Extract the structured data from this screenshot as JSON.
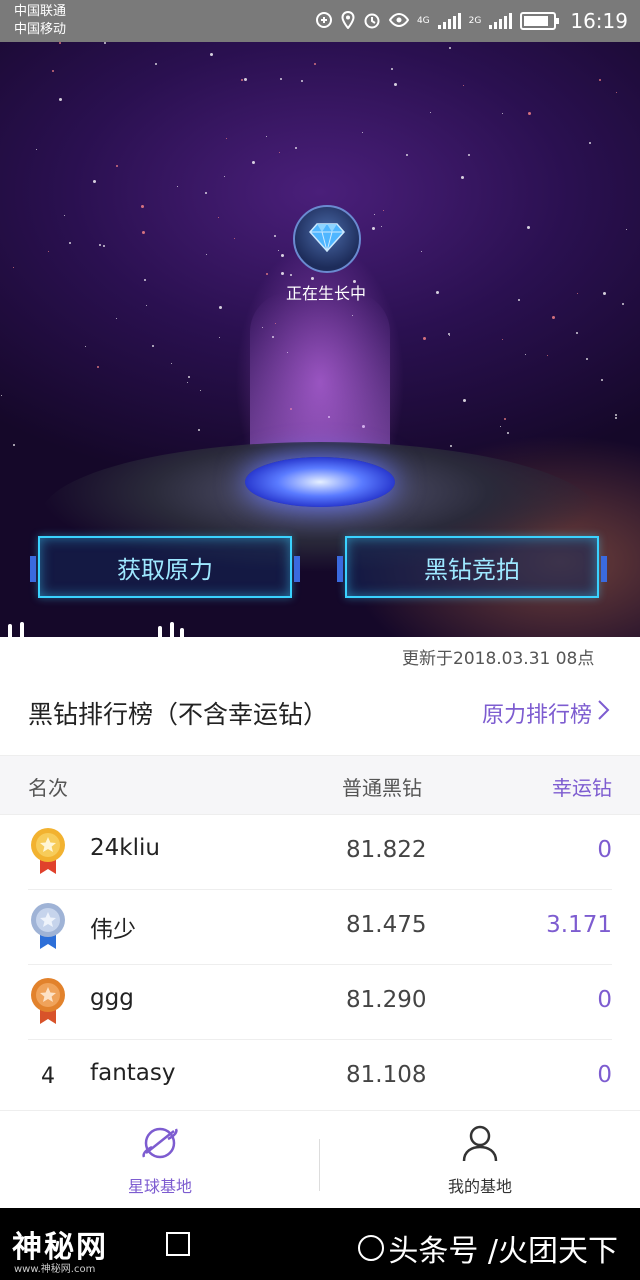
{
  "statusbar": {
    "carrier1": "中国联通",
    "carrier2": "中国移动",
    "net1": "4G",
    "net2": "2G",
    "battery_level": 0.85,
    "time": "16:19"
  },
  "hero": {
    "growing_label": "正在生长中",
    "btn_get_force": "获取原力",
    "btn_auction": "黑钻竞拍"
  },
  "ranking": {
    "updated": "更新于2018.03.31 08点",
    "title": "黑钻排行榜（不含幸运钻）",
    "force_link": "原力排行榜",
    "columns": {
      "rank": "名次",
      "normal": "普通黑钻",
      "lucky": "幸运钻"
    },
    "rows": [
      {
        "medal": "gold",
        "name": "24kliu",
        "normal": "81.822",
        "lucky": "0"
      },
      {
        "medal": "silver",
        "name": "伟少",
        "normal": "81.475",
        "lucky": "3.171"
      },
      {
        "medal": "bronze",
        "name": "ggg",
        "normal": "81.290",
        "lucky": "0"
      },
      {
        "rank": "4",
        "name": "fantasy",
        "normal": "81.108",
        "lucky": "0"
      }
    ]
  },
  "tabs": {
    "planet_base": "星球基地",
    "my_base": "我的基地"
  },
  "watermark": {
    "left": "神秘网",
    "left_sub": "www.神秘网.com",
    "right": "头条号 /火团天下"
  },
  "colors": {
    "accent": "#7d5cd0",
    "neon": "#3ad2ff",
    "gold": "#f2b230",
    "silver": "#9fb3d6",
    "bronze": "#e2822c"
  }
}
